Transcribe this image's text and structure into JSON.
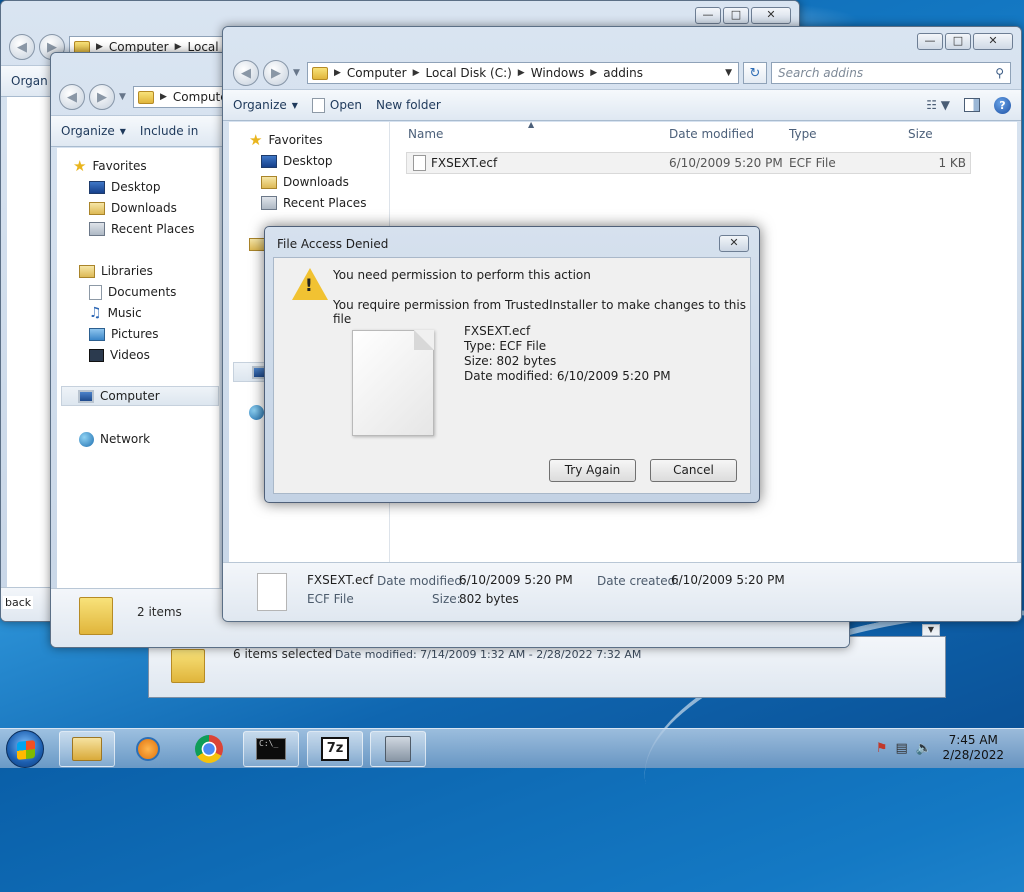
{
  "colors": {
    "accent": "#1e395b",
    "desktop": "#1479c4",
    "warning": "#f1c232"
  },
  "back_window2": {
    "breadcrumb": [
      "Computer",
      "Local"
    ],
    "toolbar": {
      "organize": "Organ"
    },
    "status": {
      "items_selected": "6 items selected",
      "date_modified": "Date modified: 7/14/2009 1:32 AM - 2/28/2022 7:32 AM"
    },
    "edge_label": "back"
  },
  "back_window1": {
    "breadcrumb": [
      "Computer"
    ],
    "toolbar": {
      "organize": "Organize",
      "include": "Include in"
    },
    "nav": {
      "favorites": "Favorites",
      "desktop": "Desktop",
      "downloads": "Downloads",
      "recent": "Recent Places",
      "libraries": "Libraries",
      "documents": "Documents",
      "music": "Music",
      "pictures": "Pictures",
      "videos": "Videos",
      "computer": "Computer",
      "network": "Network"
    },
    "status": {
      "items": "2 items"
    }
  },
  "front_window": {
    "breadcrumb": [
      "Computer",
      "Local Disk (C:)",
      "Windows",
      "addins"
    ],
    "search_placeholder": "Search addins",
    "toolbar": {
      "organize": "Organize",
      "open": "Open",
      "new_folder": "New folder"
    },
    "nav": {
      "favorites": "Favorites",
      "desktop": "Desktop",
      "downloads": "Downloads",
      "recent": "Recent Places"
    },
    "columns": {
      "name": "Name",
      "date": "Date modified",
      "type": "Type",
      "size": "Size"
    },
    "files": [
      {
        "name": "FXSEXT.ecf",
        "date": "6/10/2009 5:20 PM",
        "type": "ECF File",
        "size": "1 KB"
      }
    ],
    "details": {
      "name": "FXSEXT.ecf",
      "type": "ECF File",
      "date_modified_label": "Date modified:",
      "date_modified": "6/10/2009 5:20 PM",
      "date_created_label": "Date created:",
      "date_created": "6/10/2009 5:20 PM",
      "size_label": "Size:",
      "size": "802 bytes"
    }
  },
  "dialog": {
    "title": "File Access Denied",
    "message1": "You need permission to perform this action",
    "message2": "You require permission from TrustedInstaller to make changes to this file",
    "file_name": "FXSEXT.ecf",
    "file_type": "Type: ECF File",
    "file_size": "Size: 802 bytes",
    "file_date": "Date modified: 6/10/2009 5:20 PM",
    "try_again": "Try Again",
    "cancel": "Cancel"
  },
  "taskbar": {
    "time": "7:45 AM",
    "date": "2/28/2022",
    "apps": [
      "explorer-icon",
      "media-player-icon",
      "chrome-icon",
      "cmd-icon",
      "7zip-icon",
      "network-tool-icon"
    ],
    "sevenzip_label": "7z"
  }
}
